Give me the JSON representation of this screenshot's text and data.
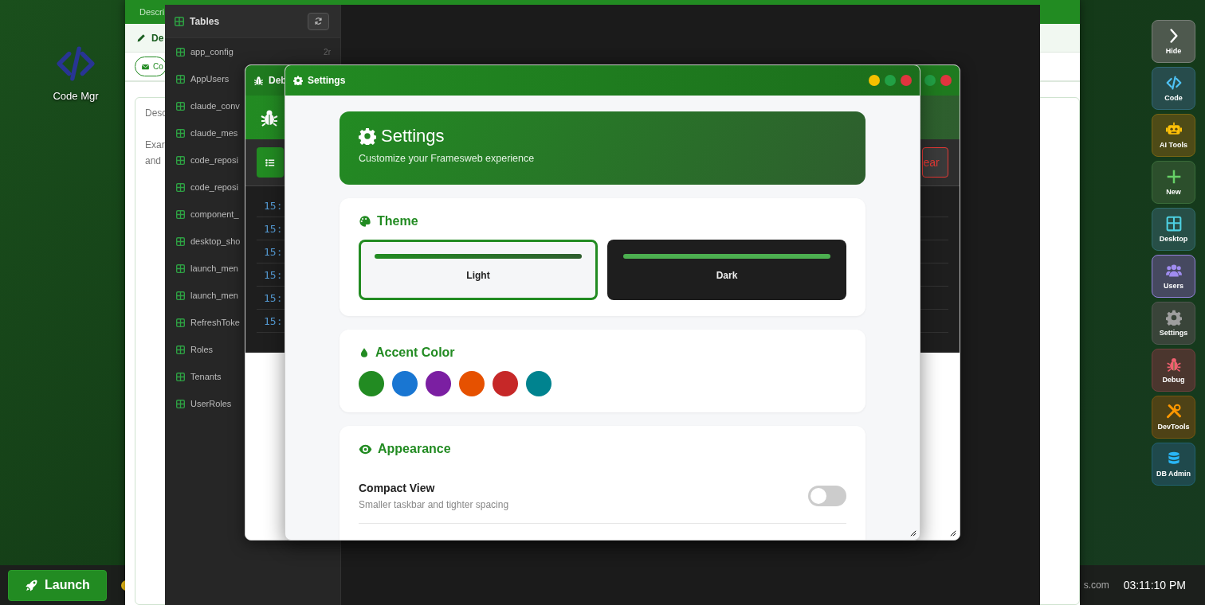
{
  "desktop_icons": [
    {
      "label": "Code Mgr"
    }
  ],
  "taskbar": {
    "launch": "Launch",
    "site_text": "s.com",
    "clock": "03:11:10 PM"
  },
  "form_window": {
    "header": "Descri",
    "section_title": "De",
    "button": "Co",
    "card_label": "Desc",
    "card_lines": [
      "Exar",
      "and"
    ]
  },
  "db_window": {
    "sidebar_title": "Tables",
    "tables": [
      {
        "name": "app_config",
        "count": "2r"
      },
      {
        "name": "AppUsers"
      },
      {
        "name": "claude_conv"
      },
      {
        "name": "claude_mes"
      },
      {
        "name": "code_reposi"
      },
      {
        "name": "code_reposi"
      },
      {
        "name": "component_"
      },
      {
        "name": "desktop_sho"
      },
      {
        "name": "launch_men"
      },
      {
        "name": "launch_men"
      },
      {
        "name": "RefreshToke"
      },
      {
        "name": "Roles"
      },
      {
        "name": "Tenants"
      },
      {
        "name": "UserRoles"
      }
    ]
  },
  "debug_window": {
    "title": "Deb",
    "clear_button": "ear",
    "log_times": [
      "15:",
      "15:",
      "15:",
      "15:",
      "15:",
      "15:"
    ]
  },
  "settings_window": {
    "title": "Settings",
    "hero_title": "Settings",
    "hero_subtitle": "Customize your Framesweb experience",
    "theme": {
      "title": "Theme",
      "options": [
        {
          "label": "Light",
          "kind": "light",
          "selected": true
        },
        {
          "label": "Dark",
          "kind": "dark",
          "selected": false
        }
      ]
    },
    "accent": {
      "title": "Accent Color",
      "colors": [
        {
          "color": "#228b22"
        },
        {
          "color": "#1976d2"
        },
        {
          "color": "#7b1fa2"
        },
        {
          "color": "#e65100"
        },
        {
          "color": "#c62828"
        },
        {
          "color": "#00838f"
        }
      ]
    },
    "appearance": {
      "title": "Appearance",
      "options": [
        {
          "label": "Compact View",
          "description": "Smaller taskbar and tighter spacing",
          "on": false
        }
      ]
    }
  },
  "dock": [
    {
      "label": "Hide",
      "color": "#ffffff",
      "selected": false
    },
    {
      "label": "Code",
      "color": "#4fc3f7",
      "selected": false
    },
    {
      "label": "AI Tools",
      "color": "#ffc107",
      "selected": false
    },
    {
      "label": "New",
      "color": "#66d066",
      "selected": false
    },
    {
      "label": "Desktop",
      "color": "#4dd0e1",
      "selected": false
    },
    {
      "label": "Users",
      "color": "#a08cf0",
      "selected": true
    },
    {
      "label": "Settings",
      "color": "#9e9e9e",
      "selected": false
    },
    {
      "label": "Debug",
      "color": "#f06070",
      "selected": false
    },
    {
      "label": "DevTools",
      "color": "#ff9800",
      "selected": false
    },
    {
      "label": "DB Admin",
      "color": "#29b6f6",
      "selected": false
    }
  ]
}
